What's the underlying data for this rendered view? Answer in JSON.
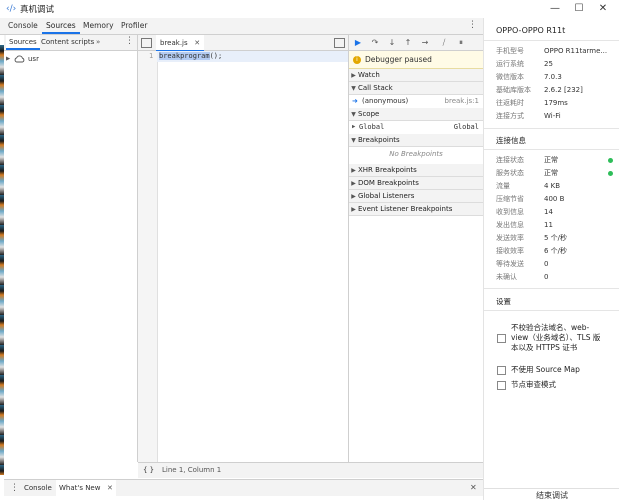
{
  "window": {
    "title": "真机调试",
    "logo_glyph": "‹/›",
    "minimize_glyph": "—",
    "maximize_glyph": "☐",
    "close_glyph": "✕"
  },
  "devtools": {
    "main_tabs": [
      "Console",
      "Sources",
      "Memory",
      "Profiler"
    ],
    "active_main_tab": "Sources",
    "navigator": {
      "tabs": [
        "Sources",
        "Content scripts"
      ],
      "more_glyph": "»",
      "tree": [
        {
          "label": "usr",
          "expand": "▶"
        }
      ]
    },
    "editor": {
      "file_tab": "break.js",
      "line_number": "1",
      "code_highlight": "breakprogram",
      "code_rest": "();"
    },
    "status": {
      "braces": "{ }",
      "position": "Line 1, Column 1"
    },
    "drawer_tabs": [
      "Console",
      "What's New"
    ],
    "debugger": {
      "paused_text": "Debugger paused",
      "sections": {
        "watch": "Watch",
        "call_stack": "Call Stack",
        "scope": "Scope",
        "breakpoints": "Breakpoints",
        "xhr": "XHR Breakpoints",
        "dom": "DOM Breakpoints",
        "global_listeners": "Global Listeners",
        "event_listener": "Event Listener Breakpoints"
      },
      "call_stack_frame": {
        "name": "(anonymous)",
        "location": "break.js:1"
      },
      "scope_row": {
        "name": "Global",
        "value": "Global"
      },
      "no_breakpoints": "No Breakpoints"
    }
  },
  "device_panel": {
    "device_name": "OPPO-OPPO R11t",
    "info": [
      {
        "key": "手机型号",
        "value": "OPPO R11tarme..."
      },
      {
        "key": "运行系统",
        "value": "25"
      },
      {
        "key": "微信版本",
        "value": "7.0.3"
      },
      {
        "key": "基础库版本",
        "value": "2.6.2 [232]"
      },
      {
        "key": "往返耗时",
        "value": "179ms"
      },
      {
        "key": "连接方式",
        "value": "Wi-Fi"
      }
    ],
    "connection_header": "连接信息",
    "connection": [
      {
        "key": "连接状态",
        "value": "正常",
        "status": true
      },
      {
        "key": "服务状态",
        "value": "正常",
        "status": true
      },
      {
        "key": "流量",
        "value": "4 KB"
      },
      {
        "key": "压缩节省",
        "value": "400 B"
      },
      {
        "key": "收到信息",
        "value": "14"
      },
      {
        "key": "发出信息",
        "value": "11"
      },
      {
        "key": "发送效率",
        "value": "5 个/秒"
      },
      {
        "key": "接收效率",
        "value": "6 个/秒"
      },
      {
        "key": "等待发送",
        "value": "0"
      },
      {
        "key": "未确认",
        "value": "0"
      }
    ],
    "settings_header": "设置",
    "settings": [
      {
        "label_lines": [
          "不校验合法域名、web-",
          "view（业务域名）、TLS 版",
          "本以及 HTTPS 证书"
        ]
      },
      {
        "label_lines": [
          "不使用 Source Map"
        ]
      },
      {
        "label_lines": [
          "节点审查模式"
        ]
      }
    ],
    "end_button": "结束调试"
  },
  "colors": {
    "accent": "#1a73e8",
    "ok": "#2ebd59",
    "paused_bg": "#fffbe6"
  }
}
